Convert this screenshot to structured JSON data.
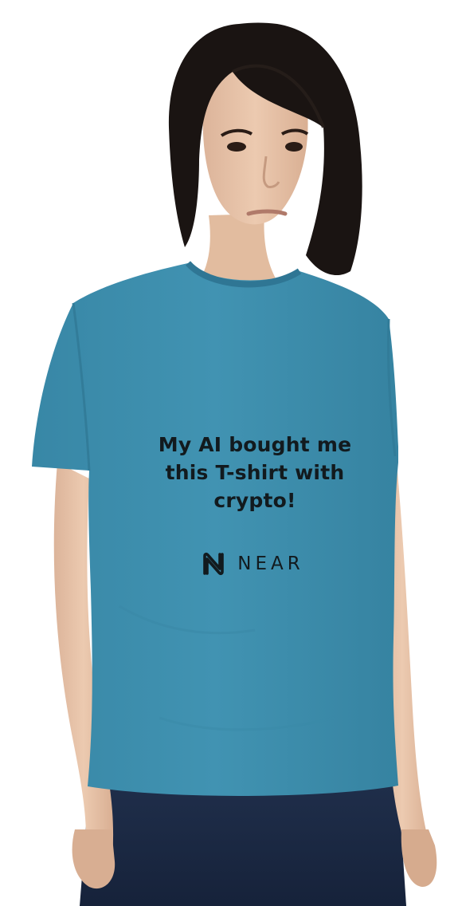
{
  "shirt": {
    "slogan_lines": [
      "My AI bought me",
      "this T-shirt with",
      "crypto!"
    ],
    "brand_name": "NEAR",
    "logo_icon": "near-logo-icon"
  },
  "colors": {
    "shirt": "#3d8eac",
    "print": "#121a1e",
    "hair": "#1a1412",
    "skin": "#e8c4a8",
    "jeans": "#1c2a44",
    "background": "#ffffff"
  }
}
